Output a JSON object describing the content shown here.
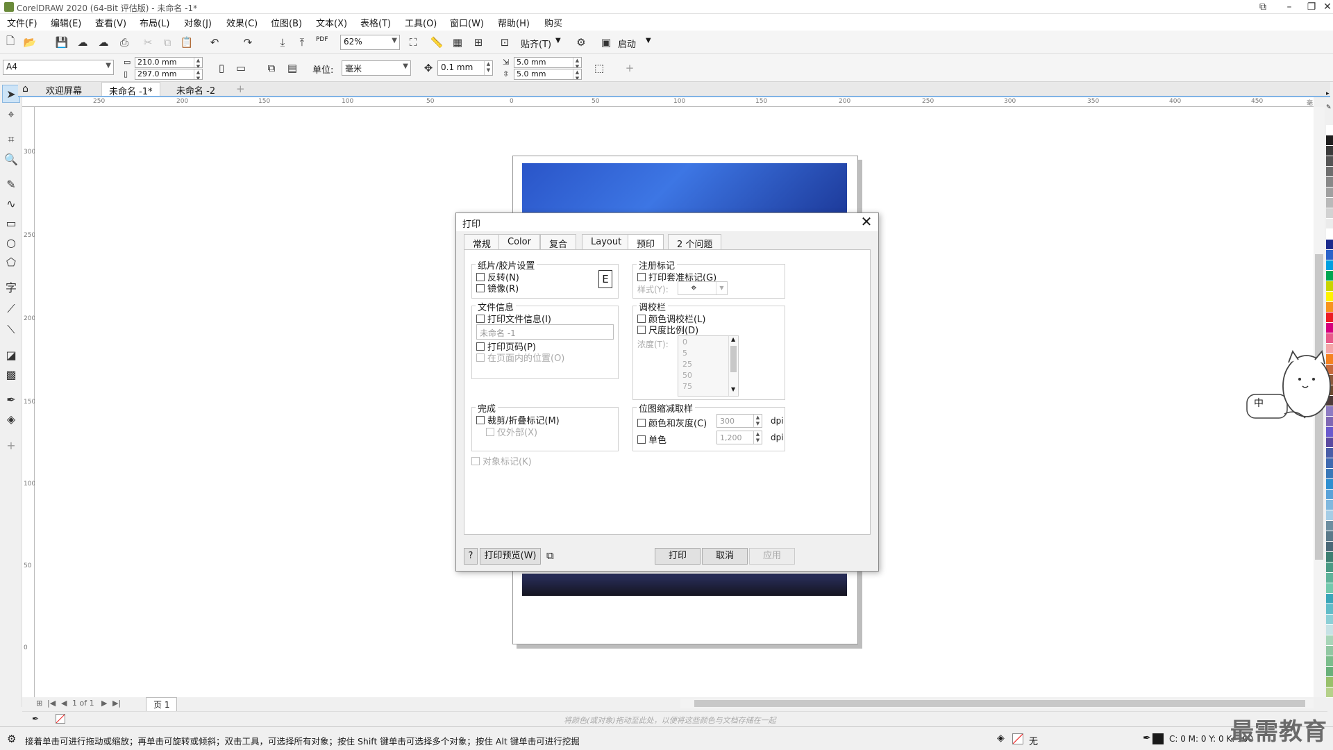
{
  "window": {
    "title": "CorelDRAW 2020 (64-Bit 评估版) - 未命名 -1*"
  },
  "menu": [
    "文件(F)",
    "编辑(E)",
    "查看(V)",
    "布局(L)",
    "对象(J)",
    "效果(C)",
    "位图(B)",
    "文本(X)",
    "表格(T)",
    "工具(O)",
    "窗口(W)",
    "帮助(H)",
    "购买"
  ],
  "toolbar1": {
    "zoom": "62%",
    "snap_label": "贴齐(T)",
    "launch_label": "启动",
    "pdf_label": "PDF"
  },
  "toolbar2": {
    "paper": "A4",
    "width": "210.0 mm",
    "height": "297.0 mm",
    "units_label": "单位:",
    "units_value": "毫米",
    "nudge": "0.1 mm",
    "dup_x": "5.0 mm",
    "dup_y": "5.0 mm"
  },
  "doc_tabs": [
    "欢迎屏幕",
    "未命名 -1*",
    "未命名 -2"
  ],
  "ruler": {
    "h_ticks": [
      "250",
      "200",
      "150",
      "100",
      "50",
      "0",
      "50",
      "100",
      "150",
      "200",
      "250",
      "300",
      "350",
      "400",
      "450",
      "毫米"
    ],
    "v_ticks": [
      "300",
      "250",
      "200",
      "150",
      "100",
      "50",
      "0"
    ]
  },
  "page_nav": {
    "count": "1 of 1",
    "page_tab": "页 1"
  },
  "color_hint": "将颜色(或对象)拖动至此处，以便将这些颜色与文档存储在一起",
  "status": {
    "message": "接着单击可进行拖动或缩放；再单击可旋转或倾斜；双击工具，可选择所有对象；按住 Shift 键单击可选择多个对象；按住 Alt 键单击可进行挖掘",
    "fill_none": "无",
    "cmyk": "C: 0 M: 0 Y: 0 K: 100"
  },
  "watermark": "最需教育",
  "mascot": {
    "label": "中"
  },
  "dialog": {
    "title": "打印",
    "tabs": [
      "常规",
      "Color",
      "复合",
      "Layout",
      "预印",
      "2 个问题"
    ],
    "active_tab": "预印",
    "paper_film": {
      "title": "纸片/胶片设置",
      "invert": "反转(N)",
      "mirror": "镜像(R)"
    },
    "file_info": {
      "title": "文件信息",
      "print_file_info": "打印文件信息(I)",
      "file_name": "未命名 -1",
      "print_page_num": "打印页码(P)",
      "position_in_page": "在页面内的位置(O)"
    },
    "finish": {
      "title": "完成",
      "crop_marks": "裁剪/折叠标记(M)",
      "exterior_only": "仅外部(X)"
    },
    "object_marks": "对象标记(K)",
    "registration": {
      "title": "注册标记",
      "print_reg_marks": "打印套准标记(G)",
      "style_label": "样式(Y):"
    },
    "calibration": {
      "title": "调校栏",
      "color_calib": "颜色调校栏(L)",
      "densitometer": "尺度比例(D)",
      "density_label": "浓度(T):",
      "density_values": [
        "0",
        "5",
        "25",
        "50",
        "75"
      ]
    },
    "downsample": {
      "title": "位图缩减取样",
      "color_gray": "颜色和灰度(C)",
      "color_gray_dpi": "300",
      "mono": "单色",
      "mono_dpi": "1,200",
      "unit": "dpi"
    },
    "buttons": {
      "help": "?",
      "preview": "打印预览(W)",
      "print": "打印",
      "cancel": "取消",
      "apply": "应用"
    }
  },
  "palette": [
    "#ffffff",
    "#1e1e1e",
    "#3a3a3a",
    "#555555",
    "#6e6e6e",
    "#888888",
    "#a0a0a0",
    "#b9b9b9",
    "#d2d2d2",
    "#ebebeb",
    "#ffffff",
    "#1b2a8c",
    "#2b63c9",
    "#00a0e0",
    "#00a651",
    "#c8d400",
    "#fff200",
    "#f7941d",
    "#ed1c24",
    "#d6007e",
    "#e85a8a",
    "#f4a6a8",
    "#f58220",
    "#c66a3b",
    "#8b5a3c",
    "#6b4a2f",
    "#4e3b3a",
    "#8e7cc3",
    "#7f68b4",
    "#6a5acd",
    "#5b4aa0",
    "#4a5ea8",
    "#3f6ab0",
    "#3a78b8",
    "#2f8fd0",
    "#5aa2d8",
    "#80b8de",
    "#a5cde6",
    "#6d8ea0",
    "#5b7a8a",
    "#4a6877",
    "#3d7f72",
    "#4a9a84",
    "#5fb39a",
    "#73c9ad",
    "#3aa6b9",
    "#61bcc8",
    "#8ccfd6",
    "#c6e2e5",
    "#a8d5b8",
    "#91c7a2",
    "#7bbd8c",
    "#68b07a",
    "#98c06b",
    "#b5d18a"
  ]
}
